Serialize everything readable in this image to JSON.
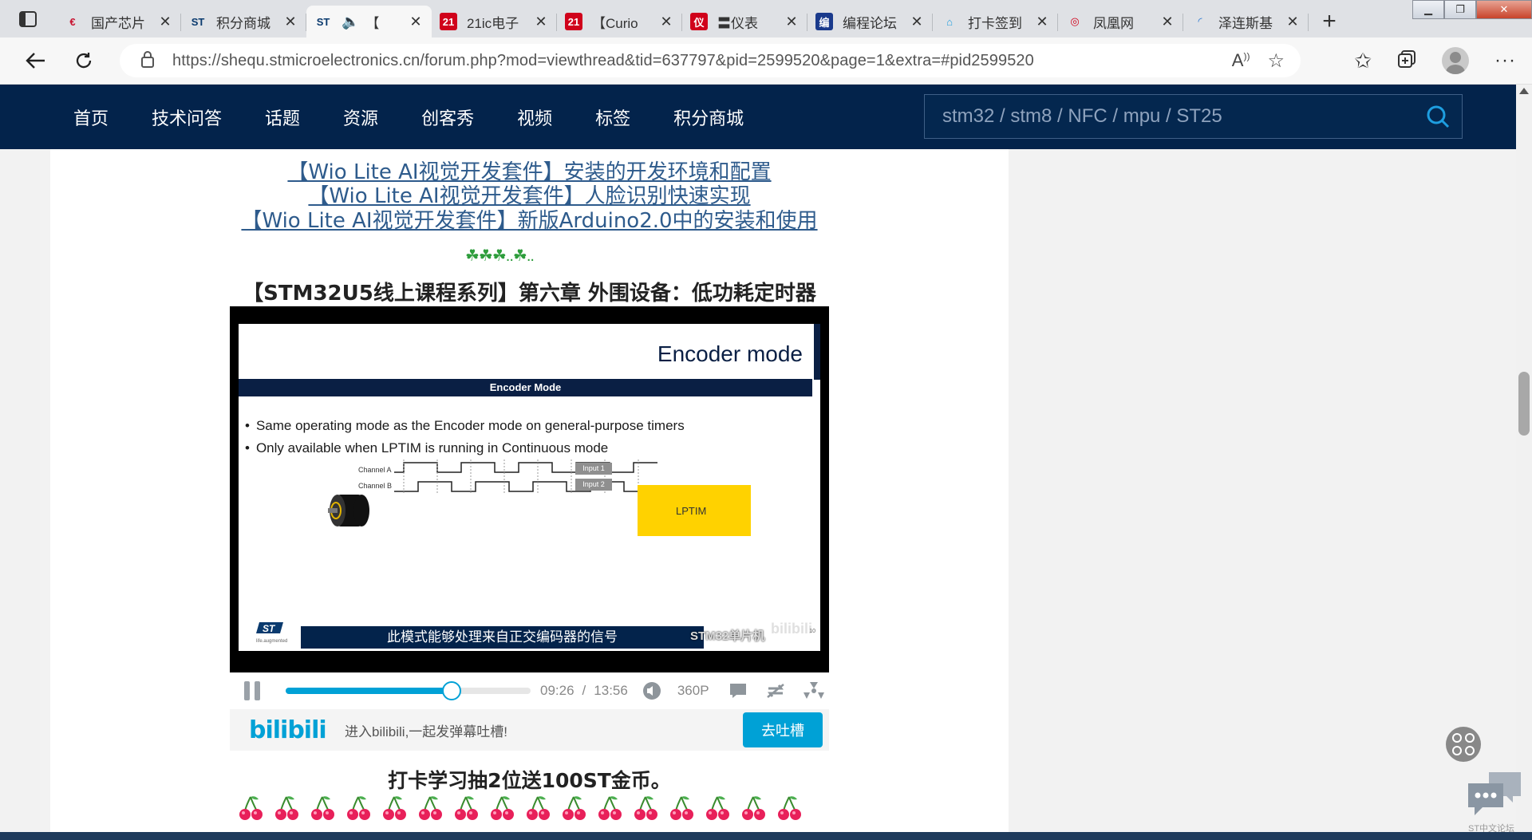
{
  "browser": {
    "tabs": [
      {
        "title": "国产芯片",
        "favicon": "red-bracket",
        "active": false
      },
      {
        "title": "积分商城",
        "favicon": "st-logo",
        "active": false
      },
      {
        "title": "【",
        "favicon": "st-logo",
        "active": true,
        "audio": true
      },
      {
        "title": "21ic电子",
        "favicon": "21ic",
        "active": false
      },
      {
        "title": "【Curio",
        "favicon": "21ic",
        "active": false
      },
      {
        "title": "〓仪表",
        "favicon": "red-shield",
        "active": false
      },
      {
        "title": "编程论坛",
        "favicon": "bian",
        "active": false
      },
      {
        "title": "打卡签到",
        "favicon": "house",
        "active": false
      },
      {
        "title": "凤凰网",
        "favicon": "phoenix",
        "active": false
      },
      {
        "title": "泽连斯基",
        "favicon": "blue-swoosh",
        "active": false
      }
    ],
    "url": "https://shequ.stmicroelectronics.cn/forum.php?mod=viewthread&tid=637797&pid=2599520&page=1&extra=#pid2599520"
  },
  "site": {
    "menu": [
      "首页",
      "技术问答",
      "话题",
      "资源",
      "创客秀",
      "视频",
      "标签",
      "积分商城"
    ],
    "search_placeholder": "stm32 / stm8 / NFC / mpu / ST25"
  },
  "post": {
    "links": [
      "【Wio Lite AI视觉开发套件】安装的开发环境和配置",
      "【Wio Lite AI视觉开发套件】人脸识别快速实现",
      "【Wio Lite AI视觉开发套件】新版Arduino2.0中的安装和使用"
    ],
    "clover_decoration": "☘☘☘..☘..",
    "video_heading": "【STM32U5线上课程系列】第六章 外围设备：低功耗定时器",
    "video": {
      "slide_title": "Encoder mode",
      "slide_band": "Encoder Mode",
      "bullets": [
        "Same operating mode as the Encoder mode on general-purpose timers",
        "Only available when LPTIM is running in Continuous mode"
      ],
      "channel_a": "Channel A",
      "channel_b": "Channel B",
      "input_1": "Input 1",
      "input_2": "Input 2",
      "lptim_label": "LPTIM",
      "logo_tagline": "life.augmented",
      "subtitle": "此模式能够处理来自正交编码器的信号",
      "watermark": "STM32单片机",
      "bili_watermark": "bilibili",
      "page_no": "10",
      "current_time": "09:26",
      "separator": "/",
      "total_time": "13:56",
      "progress": 0.677,
      "quality": "360P"
    },
    "danmaku": {
      "logo": "bilibili",
      "hint": "进入bilibili,一起发弹幕吐槽!",
      "send_label": "去吐槽"
    },
    "checkin_text": "打卡学习抽2位送100ST金币。",
    "cherry_count": 16
  },
  "floating": {
    "chat_label": "ST中文论坛"
  },
  "colors": {
    "navy": "#03234b",
    "bili_blue": "#00a1d6",
    "lptim_yellow": "#ffd200",
    "link_blue": "#2e5b8c"
  }
}
